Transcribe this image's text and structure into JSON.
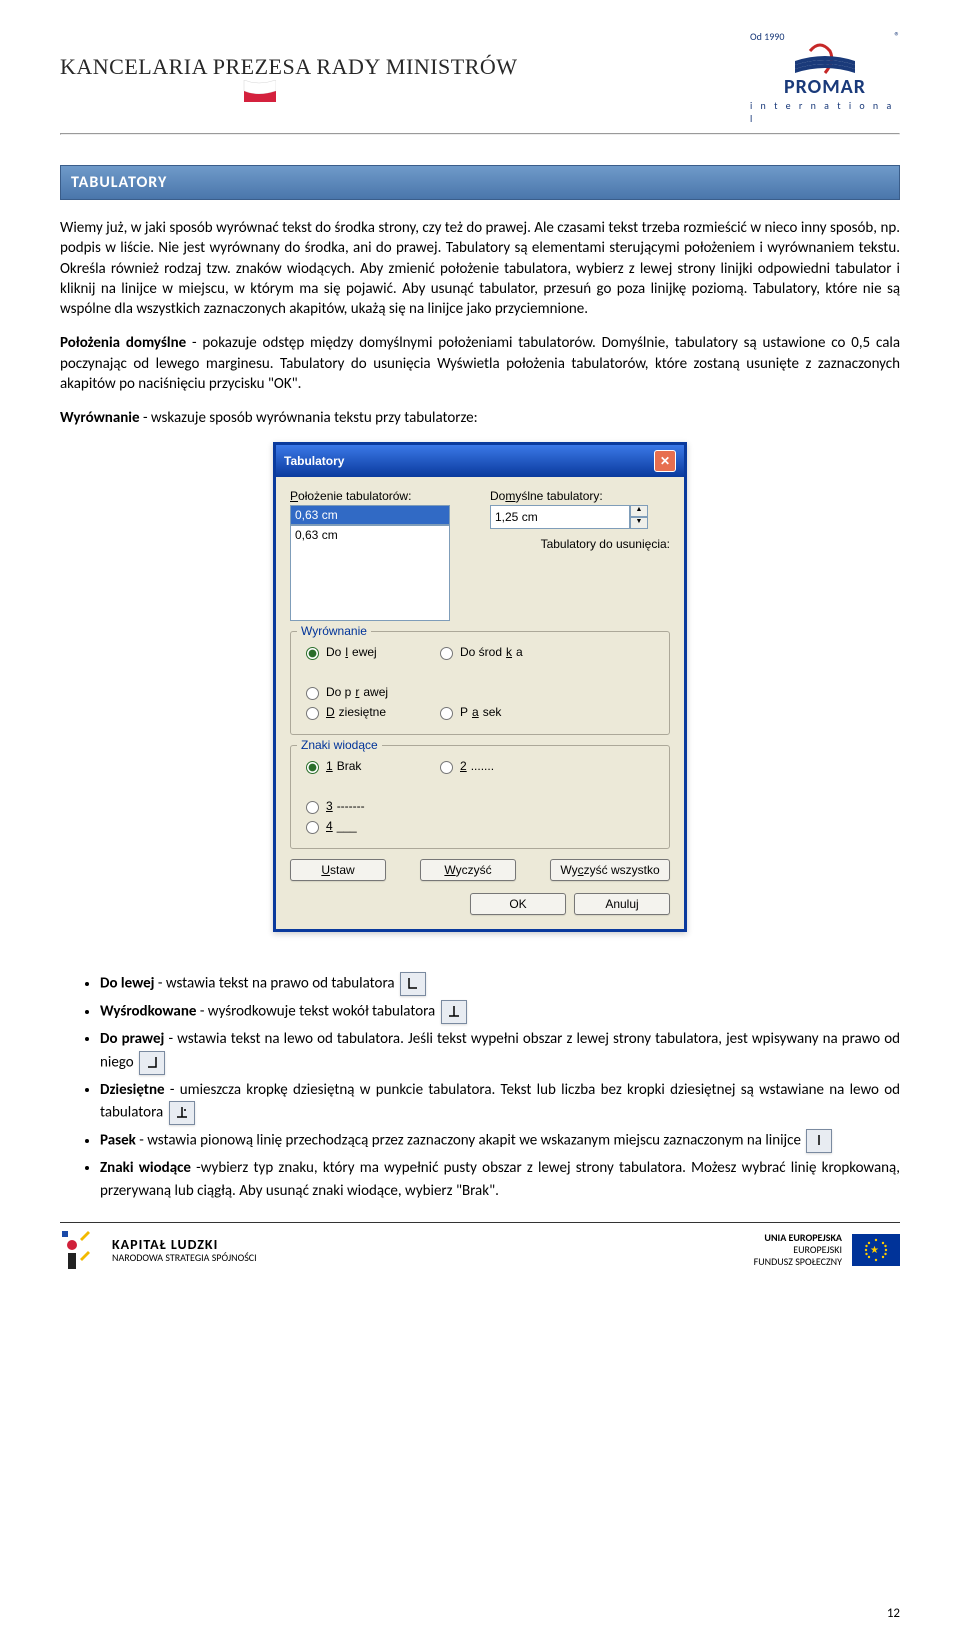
{
  "header": {
    "org": "KANCELARIA PREZESA RADY MINISTRÓW",
    "promar_since": "Od 1990",
    "promar_reg": "®",
    "promar_name": "PROMAR",
    "promar_intl": "i n t e r n a t i o n a l"
  },
  "title": "TABULATORY",
  "p1": "Wiemy już, w jaki sposób wyrównać tekst do środka strony, czy też do prawej. Ale czasami tekst trzeba rozmieścić w nieco inny sposób, np. podpis w liście. Nie jest wyrównany do środka, ani do prawej. Tabulatory są elementami sterującymi położeniem i wyrównaniem tekstu. Określa również rodzaj tzw. znaków wiodących. Aby zmienić położenie tabulatora, wybierz z lewej strony linijki odpowiedni tabulator i kliknij na linijce w miejscu, w którym ma się pojawić. Aby usunąć tabulator, przesuń go poza linijkę poziomą. Tabulatory, które nie są wspólne dla wszystkich zaznaczonych akapitów, ukażą się na linijce jako przyciemnione.",
  "p2_bold": "Położenia domyślne",
  "p2_rest": " - pokazuje odstęp między domyślnymi położeniami tabulatorów. Domyślnie, tabulatory są ustawione co 0,5 cala poczynając od lewego marginesu. Tabulatory do usunięcia Wyświetla położenia tabulatorów, które zostaną usunięte z zaznaczonych akapitów po naciśnięciu przycisku \"OK\".",
  "p3_bold": "Wyrównanie",
  "p3_rest": " - wskazuje sposób wyrównania tekstu przy tabulatorze:",
  "dialog": {
    "title": "Tabulatory",
    "pos_label": "Położenie tabulatorów:",
    "def_label": "Domyślne tabulatory:",
    "pos_value": "0,63 cm",
    "def_value": "1,25 cm",
    "list_item": "0,63 cm",
    "remove_label": "Tabulatory do usunięcia:",
    "align_legend": "Wyrównanie",
    "align_left": "Do lewej",
    "align_center": "Do środka",
    "align_right": "Do prawej",
    "align_dec": "Dziesiętne",
    "align_bar": "Pasek",
    "leader_legend": "Znaki wiodące",
    "leader_1": "1 Brak",
    "leader_2": "2 .......",
    "leader_3": "3 -------",
    "leader_4": "4 ___",
    "btn_set": "Ustaw",
    "btn_clear": "Wyczyść",
    "btn_clearall": "Wyczyść wszystko",
    "btn_ok": "OK",
    "btn_cancel": "Anuluj"
  },
  "bullets": {
    "b1_bold": "Do lewej",
    "b1_rest": " - wstawia tekst na prawo od tabulatora ",
    "b2_bold": "Wyśrodkowane",
    "b2_rest": " - wyśrodkowuje tekst wokół tabulatora ",
    "b3_bold": "Do prawej",
    "b3_rest": " - wstawia tekst na lewo od tabulatora. Jeśli tekst wypełni obszar z lewej  strony tabulatora, jest wpisywany na prawo od niego ",
    "b4_bold": "Dziesiętne",
    "b4_rest": " - umieszcza kropkę dziesiętną w punkcie tabulatora. Tekst lub liczba bez kropki dziesiętnej są wstawiane na lewo od tabulatora ",
    "b5_bold": "Pasek",
    "b5_rest": " - wstawia pionową linię przechodzącą przez zaznaczony akapit we wskazanym miejscu zaznaczonym na linijce ",
    "b6_bold": "Znaki wiodące",
    "b6_rest": " -wybierz typ znaku, który ma wypełnić pusty obszar z lewej strony tabulatora. Możesz wybrać linię kropkowaną, przerywaną lub ciągłą. Aby usunąć znaki wiodące, wybierz \"Brak\"."
  },
  "footer": {
    "kl_big": "KAPITAŁ LUDZKI",
    "kl_small": "NARODOWA STRATEGIA SPÓJNOŚCI",
    "eu_line1": "UNIA EUROPEJSKA",
    "eu_line2": "EUROPEJSKI",
    "eu_line3": "FUNDUSZ SPOŁECZNY",
    "pagenum": "12"
  }
}
